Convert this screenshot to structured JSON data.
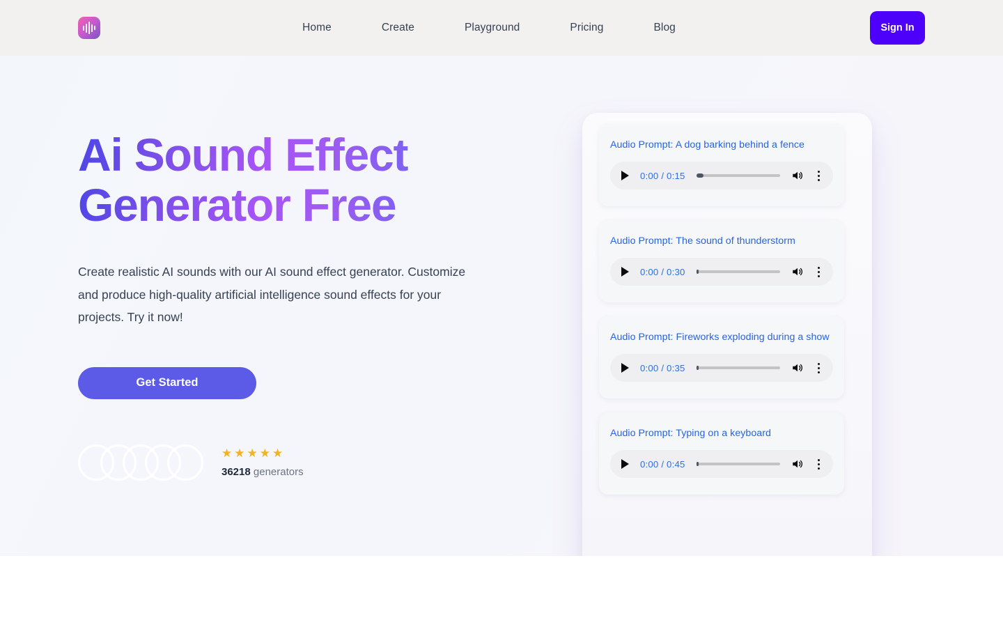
{
  "header": {
    "logo": {
      "icon": "audio-waveform-icon",
      "bars": [
        7,
        13,
        18,
        11,
        6
      ]
    },
    "nav": [
      {
        "label": "Home"
      },
      {
        "label": "Create"
      },
      {
        "label": "Playground"
      },
      {
        "label": "Pricing"
      },
      {
        "label": "Blog"
      }
    ],
    "signin_label": "Sign In",
    "background": "#f2f1ef",
    "signin_color": "#4d00fa"
  },
  "hero": {
    "headline_line1": "Ai Sound Effect",
    "headline_line2": "Generator Free",
    "headline_gradient_from": "#4f46e5",
    "headline_gradient_mid": "#a855f7",
    "headline_gradient_to": "#6366f1",
    "subcopy": "Create realistic AI sounds with our AI sound effect generator. Customize and produce high-quality artificial intelligence sound effects for your projects. Try it now!",
    "cta_label": "Get Started",
    "cta_color": "#5b5be8",
    "social": {
      "avatar_count": 5,
      "star_count": 5,
      "star_glyph": "★",
      "star_color": "#f0b323",
      "count": "36218",
      "count_label": "generators"
    }
  },
  "audio_panel": {
    "cards": [
      {
        "title": "Audio Prompt: A dog barking behind a fence",
        "time": "0:00 / 0:15",
        "progress_percent": 9,
        "play_icon": "play-icon",
        "volume_icon": "volume-icon",
        "menu_icon": "kebab-menu-icon"
      },
      {
        "title": "Audio Prompt: The sound of thunderstorm",
        "time": "0:00 / 0:30",
        "progress_percent": 3,
        "play_icon": "play-icon",
        "volume_icon": "volume-icon",
        "menu_icon": "kebab-menu-icon"
      },
      {
        "title": "Audio Prompt: Fireworks exploding during a show",
        "time": "0:00 / 0:35",
        "progress_percent": 3,
        "play_icon": "play-icon",
        "volume_icon": "volume-icon",
        "menu_icon": "kebab-menu-icon"
      },
      {
        "title": "Audio Prompt: Typing on a keyboard",
        "time": "0:00 / 0:45",
        "progress_percent": 3,
        "play_icon": "play-icon",
        "volume_icon": "volume-icon",
        "menu_icon": "kebab-menu-icon"
      }
    ],
    "title_color": "#2563eb",
    "time_color": "#2f6fe0"
  }
}
